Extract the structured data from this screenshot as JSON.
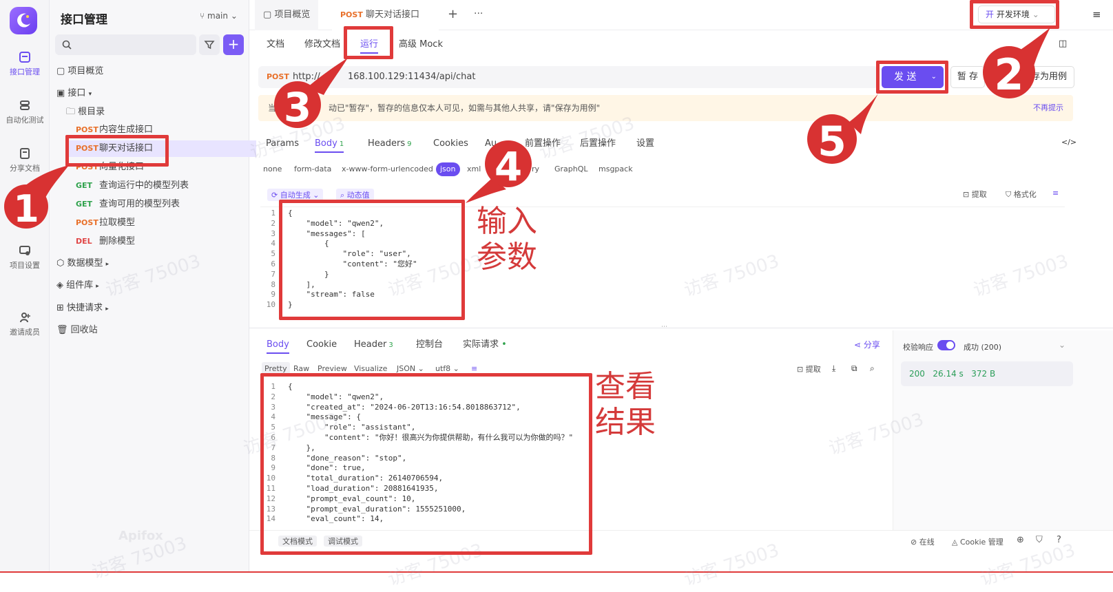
{
  "rail": {
    "items": [
      {
        "label": "接口管理",
        "icon": "api-icon"
      },
      {
        "label": "自动化测试",
        "icon": "automation-icon"
      },
      {
        "label": "分享文档",
        "icon": "share-doc-icon"
      },
      {
        "label": "项目设置",
        "icon": "settings-icon"
      },
      {
        "label": "邀请成员",
        "icon": "invite-icon"
      }
    ]
  },
  "sidebar": {
    "title": "接口管理",
    "branch": "main",
    "tree": {
      "overview": "项目概览",
      "api_group": "接口",
      "root": "根目录",
      "endpoints": [
        {
          "method": "POST",
          "name": "内容生成接口"
        },
        {
          "method": "POST",
          "name": "聊天对话接口"
        },
        {
          "method": "POST",
          "name": "向量化接口"
        },
        {
          "method": "GET",
          "name": "查询运行中的模型列表"
        },
        {
          "method": "GET",
          "name": "查询可用的模型列表"
        },
        {
          "method": "POST",
          "name": "拉取模型"
        },
        {
          "method": "DEL",
          "name": "删除模型"
        }
      ],
      "data_model": "数据模型",
      "components": "组件库",
      "quick_request": "快捷请求",
      "recycle": "回收站"
    }
  },
  "topbar": {
    "tabs": [
      {
        "label": "项目概览"
      },
      {
        "method": "POST",
        "label": "聊天对话接口"
      }
    ],
    "env_prefix": "开",
    "env_label": "开发环境"
  },
  "subtabs": [
    "文档",
    "修改文档",
    "运行",
    "高级 Mock"
  ],
  "request": {
    "method": "POST",
    "url_start": "http://",
    "url_rest": "168.100.129:11434/api/chat",
    "send_label": "发 送",
    "save_label": "暂 存",
    "save_as_label": "保存为用例",
    "notice_prefix": "当",
    "notice_text": "动已\"暂存\"，暂存的信息仅本人可见，如需与其他人共享，请\"保存为用例\"",
    "notice_dismiss": "不再提示"
  },
  "req_tabs": [
    {
      "label": "Params"
    },
    {
      "label": "Body",
      "count": "1"
    },
    {
      "label": "Headers",
      "count": "9"
    },
    {
      "label": "Cookies"
    },
    {
      "label": "Au"
    },
    {
      "label": "前置操作"
    },
    {
      "label": "后置操作"
    },
    {
      "label": "设置"
    }
  ],
  "body_types": [
    "none",
    "form-data",
    "x-www-form-urlencoded",
    "json",
    "xml",
    "ry",
    "GraphQL",
    "msgpack"
  ],
  "editor": {
    "auto_gen": "自动生成",
    "dynamic": "动态值",
    "extract": "提取",
    "format": "格式化",
    "request_lines": [
      "{",
      "    \"model\": \"qwen2\",",
      "    \"messages\": [",
      "        {",
      "            \"role\": \"user\",",
      "            \"content\": \"您好\"",
      "        }",
      "    ],",
      "    \"stream\": false",
      "}"
    ]
  },
  "response": {
    "tabs": [
      {
        "label": "Body"
      },
      {
        "label": "Cookie"
      },
      {
        "label": "Header",
        "count": "3"
      },
      {
        "label": "控制台"
      },
      {
        "label": "实际请求"
      }
    ],
    "share": "分享",
    "formats": [
      "Pretty",
      "Raw",
      "Preview",
      "Visualize",
      "JSON",
      "utf8"
    ],
    "extract": "提取",
    "lines": [
      "{",
      "    \"model\": \"qwen2\",",
      "    \"created_at\": \"2024-06-20T13:16:54.8018863712\",",
      "    \"message\": {",
      "        \"role\": \"assistant\",",
      "        \"content\": \"你好！很高兴为你提供帮助，有什么我可以为你做的吗？\"",
      "    },",
      "    \"done_reason\": \"stop\",",
      "    \"done\": true,",
      "    \"total_duration\": 26140706594,",
      "    \"load_duration\": 20881641935,",
      "    \"prompt_eval_count\": 10,",
      "    \"prompt_eval_duration\": 1555251000,",
      "    \"eval_count\": 14,"
    ],
    "validate_label": "校验响应",
    "success_label": "成功 (200)",
    "status_code": "200",
    "time": "26.14 s",
    "size": "372 B",
    "mode_doc": "文档模式",
    "mode_debug": "调试模式"
  },
  "footer": {
    "online": "在线",
    "cookie_mgmt": "Cookie 管理"
  },
  "annotations": {
    "numbers": [
      "1",
      "2",
      "3",
      "4",
      "5"
    ],
    "input_note": [
      "输入",
      "参数"
    ],
    "result_note": [
      "查看",
      "结果"
    ],
    "color": "#e03a3a"
  },
  "watermark": "访客 75003",
  "brand_watermark": "Apifox",
  "colors": {
    "accent": "#6a4df0",
    "post": "#e8702a",
    "get": "#2fa24c",
    "del": "#e04545"
  }
}
